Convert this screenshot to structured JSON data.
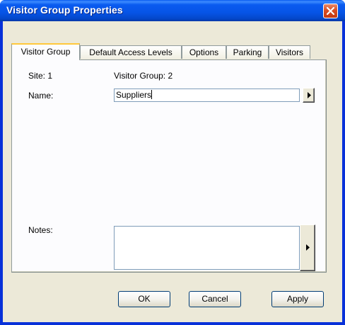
{
  "window": {
    "title": "Visitor Group Properties",
    "close_glyph": "close-icon"
  },
  "tabs": [
    {
      "label": "Visitor Group",
      "active": true
    },
    {
      "label": "Default Access Levels",
      "active": false
    },
    {
      "label": "Options",
      "active": false
    },
    {
      "label": "Parking",
      "active": false
    },
    {
      "label": "Visitors",
      "active": false
    }
  ],
  "form": {
    "site_label": "Site: 1",
    "visitor_group_label": "Visitor Group: 2",
    "name_label": "Name:",
    "name_value": "Suppliers",
    "notes_label": "Notes:",
    "notes_value": ""
  },
  "buttons": {
    "ok": "OK",
    "cancel": "Cancel",
    "apply": "Apply"
  },
  "colors": {
    "titlebar": "#0a5bf0",
    "dialog_face": "#ece9d8",
    "active_tab_accent": "#ffc83c"
  }
}
